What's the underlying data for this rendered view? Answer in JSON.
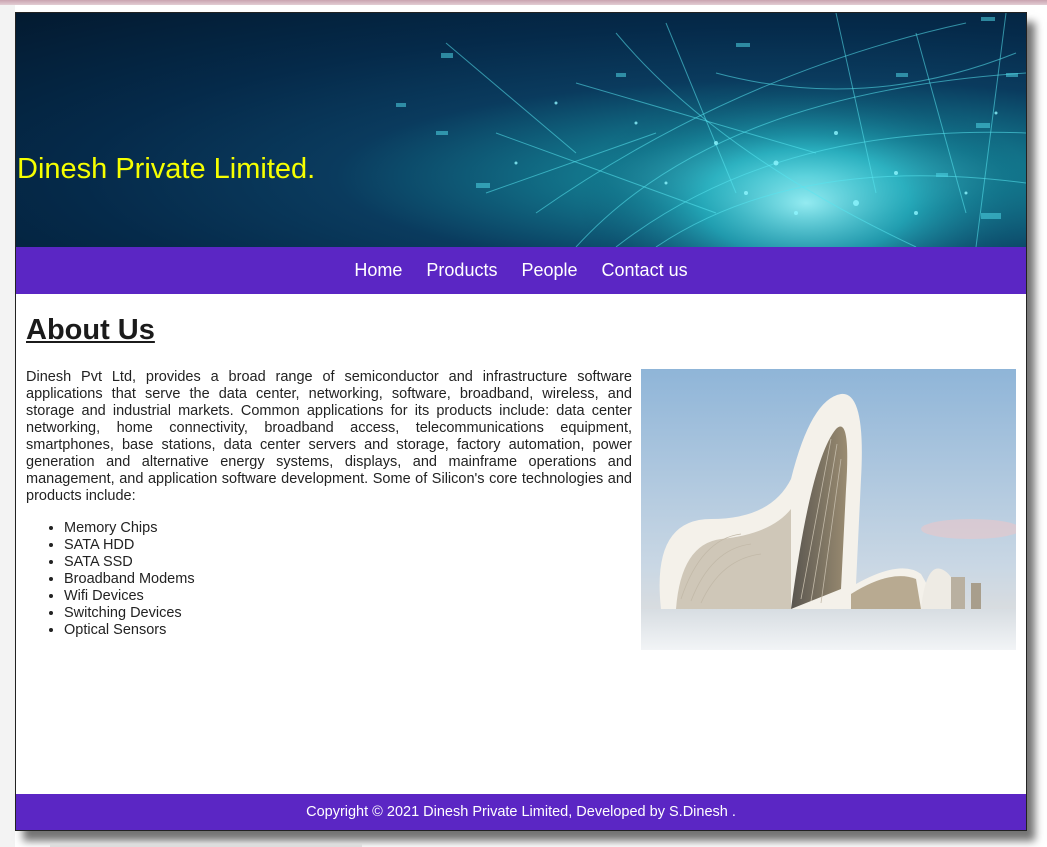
{
  "site": {
    "title": "Dinesh Private Limited."
  },
  "nav": {
    "items": [
      {
        "label": "Home"
      },
      {
        "label": "Products"
      },
      {
        "label": "People"
      },
      {
        "label": "Contact us"
      }
    ]
  },
  "about": {
    "heading": "About Us",
    "body": "Dinesh Pvt Ltd, provides a broad range of semiconductor and infrastructure software applications that serve the data center, networking, software, broadband, wireless, and storage and industrial markets. Common applications for its products include: data center networking, home connectivity, broadband access, telecommunications equipment, smartphones, base stations, data center servers and storage, factory automation, power generation and alternative energy systems, displays, and mainframe operations and management, and application software development. Some of Silicon's core technologies and products include:",
    "products": [
      "Memory Chips",
      "SATA HDD",
      "SATA SSD",
      "Broadband Modems",
      "Wifi Devices",
      "Switching Devices",
      "Optical Sensors"
    ]
  },
  "footer": {
    "text": "Copyright © 2021 Dinesh Private Limited, Developed by S.Dinesh ."
  },
  "colors": {
    "nav_bg": "#5b26c4",
    "title_color": "#f6ff00"
  },
  "icons": {
    "banner": "digital-globe-network-image",
    "building": "curved-white-building-photo"
  }
}
